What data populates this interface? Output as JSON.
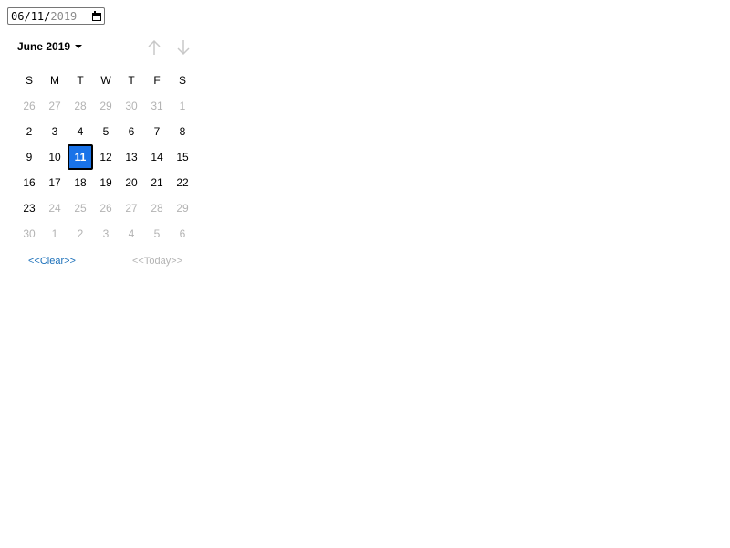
{
  "date_input": {
    "month": "06",
    "day": "11",
    "year": "2019",
    "separator": "/"
  },
  "calendar": {
    "month_label": "June 2019",
    "weekdays": [
      "S",
      "M",
      "T",
      "W",
      "T",
      "F",
      "S"
    ],
    "weeks": [
      [
        {
          "d": "26",
          "o": 1
        },
        {
          "d": "27",
          "o": 1
        },
        {
          "d": "28",
          "o": 1
        },
        {
          "d": "29",
          "o": 1
        },
        {
          "d": "30",
          "o": 1
        },
        {
          "d": "31",
          "o": 1
        },
        {
          "d": "1",
          "o": 1
        }
      ],
      [
        {
          "d": "2",
          "o": 0
        },
        {
          "d": "3",
          "o": 0
        },
        {
          "d": "4",
          "o": 0
        },
        {
          "d": "5",
          "o": 0
        },
        {
          "d": "6",
          "o": 0
        },
        {
          "d": "7",
          "o": 0
        },
        {
          "d": "8",
          "o": 0
        }
      ],
      [
        {
          "d": "9",
          "o": 0
        },
        {
          "d": "10",
          "o": 0
        },
        {
          "d": "11",
          "o": 0,
          "selected": true
        },
        {
          "d": "12",
          "o": 0
        },
        {
          "d": "13",
          "o": 0
        },
        {
          "d": "14",
          "o": 0
        },
        {
          "d": "15",
          "o": 0
        }
      ],
      [
        {
          "d": "16",
          "o": 0
        },
        {
          "d": "17",
          "o": 0
        },
        {
          "d": "18",
          "o": 0
        },
        {
          "d": "19",
          "o": 0
        },
        {
          "d": "20",
          "o": 0
        },
        {
          "d": "21",
          "o": 0
        },
        {
          "d": "22",
          "o": 0
        }
      ],
      [
        {
          "d": "23",
          "o": 0
        },
        {
          "d": "24",
          "o": 1
        },
        {
          "d": "25",
          "o": 1
        },
        {
          "d": "26",
          "o": 1
        },
        {
          "d": "27",
          "o": 1
        },
        {
          "d": "28",
          "o": 1
        },
        {
          "d": "29",
          "o": 1
        }
      ],
      [
        {
          "d": "30",
          "o": 1
        },
        {
          "d": "1",
          "o": 1
        },
        {
          "d": "2",
          "o": 1
        },
        {
          "d": "3",
          "o": 1
        },
        {
          "d": "4",
          "o": 1
        },
        {
          "d": "5",
          "o": 1
        },
        {
          "d": "6",
          "o": 1
        }
      ]
    ],
    "clear_label": "<<Clear>>",
    "today_label": "<<Today>>",
    "colors": {
      "selected_bg": "#1a73e8",
      "other_month": "#b3b3b3",
      "link": "#1a6fb9"
    }
  }
}
